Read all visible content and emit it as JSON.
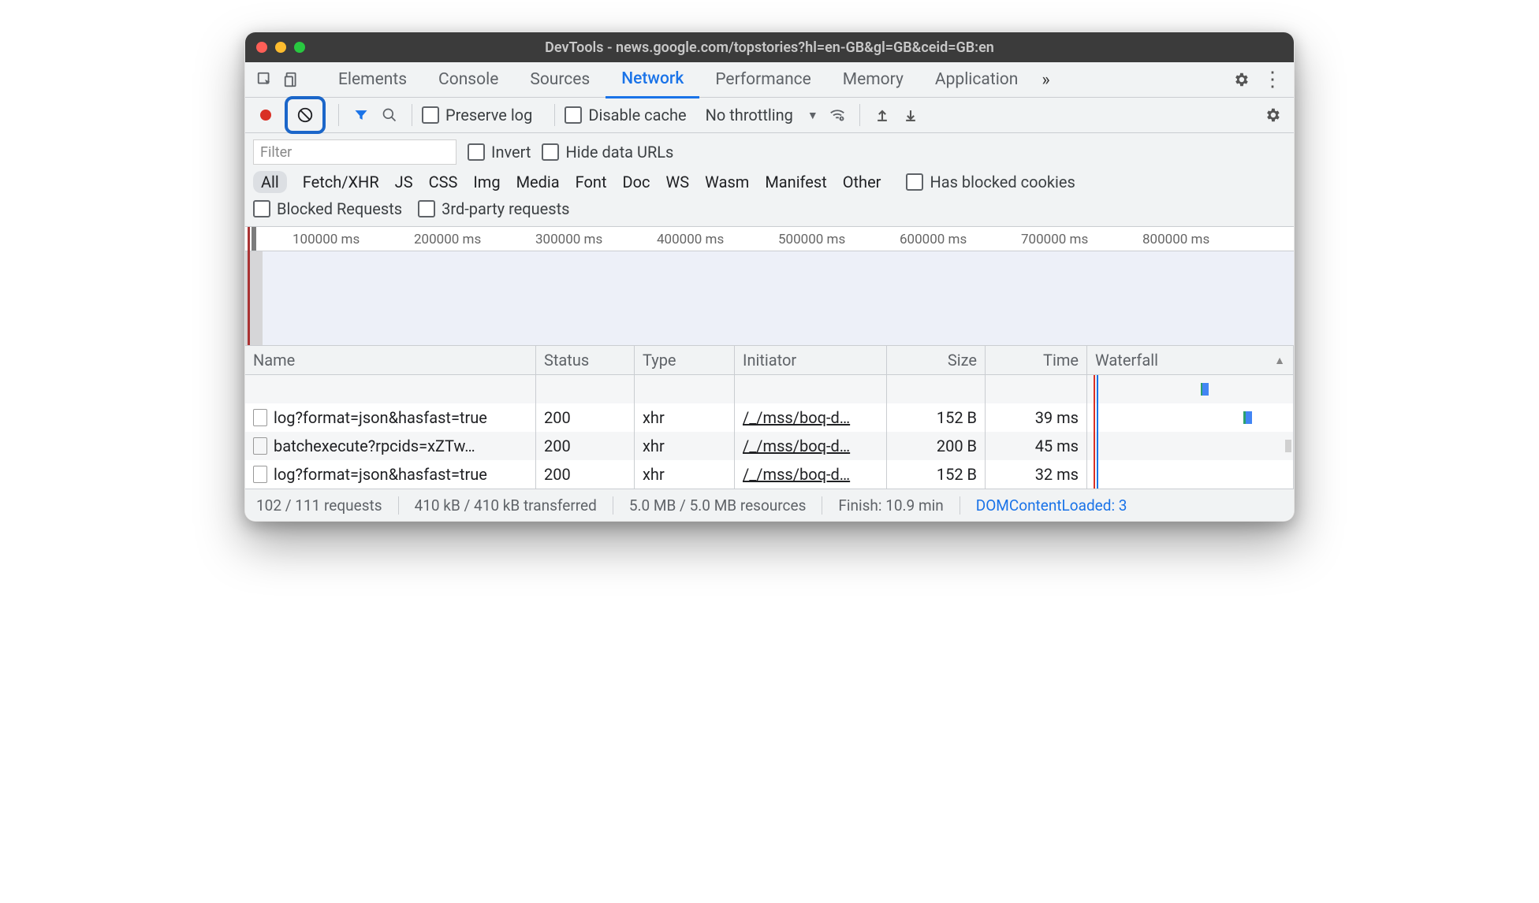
{
  "window": {
    "title": "DevTools - news.google.com/topstories?hl=en-GB&gl=GB&ceid=GB:en"
  },
  "tabs": {
    "items": [
      "Elements",
      "Console",
      "Sources",
      "Network",
      "Performance",
      "Memory",
      "Application"
    ],
    "active": "Network"
  },
  "toolbar": {
    "preserve_log": "Preserve log",
    "disable_cache": "Disable cache",
    "throttling": "No throttling"
  },
  "filter": {
    "placeholder": "Filter",
    "invert": "Invert",
    "hide_data_urls": "Hide data URLs",
    "types": [
      "All",
      "Fetch/XHR",
      "JS",
      "CSS",
      "Img",
      "Media",
      "Font",
      "Doc",
      "WS",
      "Wasm",
      "Manifest",
      "Other"
    ],
    "active_type": "All",
    "has_blocked_cookies": "Has blocked cookies",
    "blocked_requests": "Blocked Requests",
    "third_party": "3rd-party requests"
  },
  "timeline": {
    "ticks": [
      "100000 ms",
      "200000 ms",
      "300000 ms",
      "400000 ms",
      "500000 ms",
      "600000 ms",
      "700000 ms",
      "800000 ms"
    ]
  },
  "table": {
    "headers": {
      "name": "Name",
      "status": "Status",
      "type": "Type",
      "initiator": "Initiator",
      "size": "Size",
      "time": "Time",
      "waterfall": "Waterfall"
    },
    "rows": [
      {
        "name": "log?format=json&hasfast=true",
        "status": "200",
        "type": "xhr",
        "initiator": "/_/mss/boq-d…",
        "size": "152 B",
        "time": "39 ms"
      },
      {
        "name": "batchexecute?rpcids=xZTw…",
        "status": "200",
        "type": "xhr",
        "initiator": "/_/mss/boq-d…",
        "size": "200 B",
        "time": "45 ms"
      },
      {
        "name": "log?format=json&hasfast=true",
        "status": "200",
        "type": "xhr",
        "initiator": "/_/mss/boq-d…",
        "size": "152 B",
        "time": "32 ms"
      }
    ]
  },
  "status": {
    "requests": "102 / 111 requests",
    "transferred": "410 kB / 410 kB transferred",
    "resources": "5.0 MB / 5.0 MB resources",
    "finish": "Finish: 10.9 min",
    "dcl": "DOMContentLoaded: 3"
  }
}
